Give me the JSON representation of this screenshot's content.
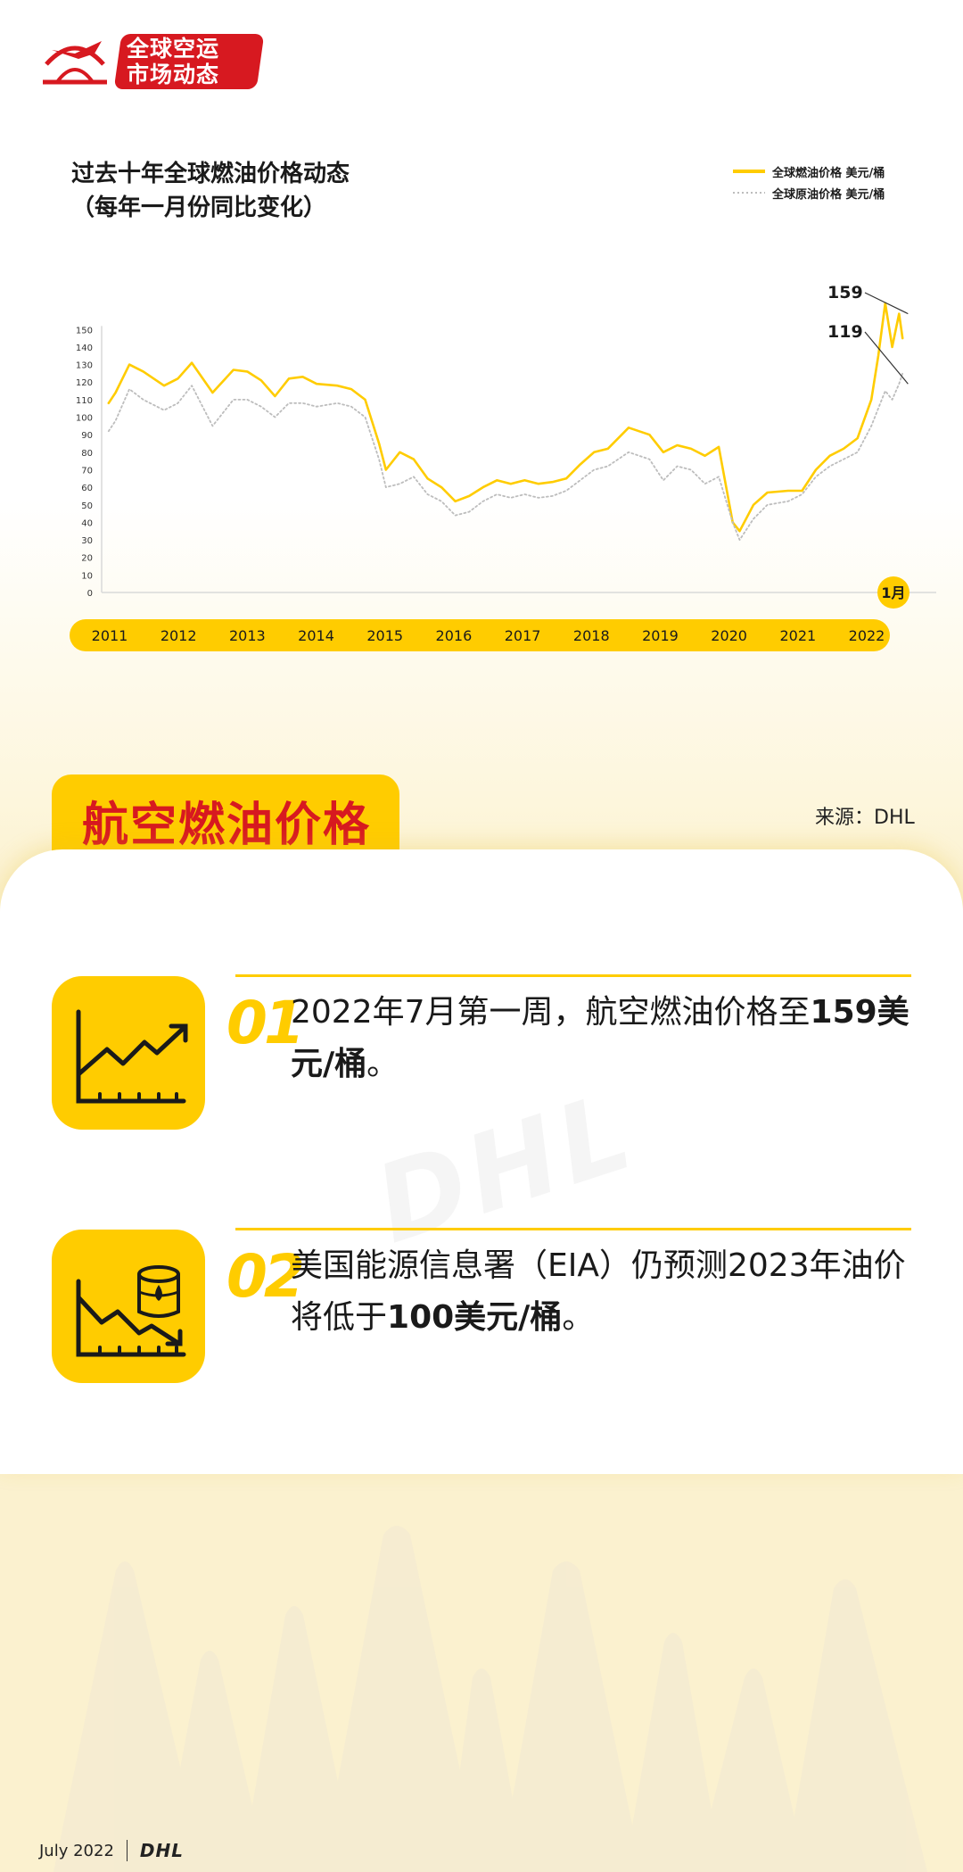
{
  "header": {
    "logo_line1": "全球空运",
    "logo_line2": "市场动态"
  },
  "chart_header": {
    "title": "过去十年全球燃油价格动态\n（每年一月份同比变化）"
  },
  "chart_data": {
    "type": "line",
    "title": "过去十年全球燃油价格动态（每年一月份同比变化）",
    "x_labels": [
      "2011",
      "2012",
      "2013",
      "2014",
      "2015",
      "2016",
      "2017",
      "2018",
      "2019",
      "2020",
      "2021",
      "2022"
    ],
    "y_ticks": [
      0,
      10,
      20,
      30,
      40,
      50,
      60,
      70,
      80,
      90,
      100,
      110,
      120,
      130,
      140,
      150
    ],
    "ylim": [
      0,
      150
    ],
    "grid": false,
    "legend": "top-right",
    "series": [
      {
        "name": "全球燃油价格 美元/桶",
        "color": "#ffcc00",
        "style": "solid",
        "points": [
          [
            2011.0,
            108
          ],
          [
            2011.1,
            114
          ],
          [
            2011.3,
            130
          ],
          [
            2011.5,
            126
          ],
          [
            2011.8,
            118
          ],
          [
            2012.0,
            122
          ],
          [
            2012.2,
            131
          ],
          [
            2012.5,
            114
          ],
          [
            2012.8,
            127
          ],
          [
            2013.0,
            126
          ],
          [
            2013.2,
            121
          ],
          [
            2013.4,
            112
          ],
          [
            2013.6,
            122
          ],
          [
            2013.8,
            123
          ],
          [
            2014.0,
            119
          ],
          [
            2014.3,
            118
          ],
          [
            2014.5,
            116
          ],
          [
            2014.7,
            110
          ],
          [
            2014.9,
            85
          ],
          [
            2015.0,
            70
          ],
          [
            2015.2,
            80
          ],
          [
            2015.4,
            76
          ],
          [
            2015.6,
            65
          ],
          [
            2015.8,
            60
          ],
          [
            2016.0,
            52
          ],
          [
            2016.2,
            55
          ],
          [
            2016.4,
            60
          ],
          [
            2016.6,
            64
          ],
          [
            2016.8,
            62
          ],
          [
            2017.0,
            64
          ],
          [
            2017.2,
            62
          ],
          [
            2017.4,
            63
          ],
          [
            2017.6,
            65
          ],
          [
            2017.8,
            73
          ],
          [
            2018.0,
            80
          ],
          [
            2018.2,
            82
          ],
          [
            2018.5,
            94
          ],
          [
            2018.8,
            90
          ],
          [
            2019.0,
            80
          ],
          [
            2019.2,
            84
          ],
          [
            2019.4,
            82
          ],
          [
            2019.6,
            78
          ],
          [
            2019.8,
            83
          ],
          [
            2020.0,
            40
          ],
          [
            2020.1,
            35
          ],
          [
            2020.3,
            50
          ],
          [
            2020.5,
            57
          ],
          [
            2020.8,
            58
          ],
          [
            2021.0,
            58
          ],
          [
            2021.2,
            70
          ],
          [
            2021.4,
            78
          ],
          [
            2021.6,
            82
          ],
          [
            2021.8,
            88
          ],
          [
            2022.0,
            110
          ],
          [
            2022.1,
            135
          ],
          [
            2022.2,
            165
          ],
          [
            2022.3,
            140
          ],
          [
            2022.4,
            159
          ],
          [
            2022.45,
            145
          ]
        ]
      },
      {
        "name": "全球原油价格 美元/桶",
        "color": "#bdbdbd",
        "style": "dotted",
        "points": [
          [
            2011.0,
            92
          ],
          [
            2011.1,
            98
          ],
          [
            2011.3,
            116
          ],
          [
            2011.5,
            110
          ],
          [
            2011.8,
            104
          ],
          [
            2012.0,
            108
          ],
          [
            2012.2,
            118
          ],
          [
            2012.5,
            95
          ],
          [
            2012.8,
            110
          ],
          [
            2013.0,
            110
          ],
          [
            2013.2,
            106
          ],
          [
            2013.4,
            100
          ],
          [
            2013.6,
            108
          ],
          [
            2013.8,
            108
          ],
          [
            2014.0,
            106
          ],
          [
            2014.3,
            108
          ],
          [
            2014.5,
            106
          ],
          [
            2014.7,
            100
          ],
          [
            2014.9,
            76
          ],
          [
            2015.0,
            60
          ],
          [
            2015.2,
            62
          ],
          [
            2015.4,
            66
          ],
          [
            2015.6,
            56
          ],
          [
            2015.8,
            52
          ],
          [
            2016.0,
            44
          ],
          [
            2016.2,
            46
          ],
          [
            2016.4,
            52
          ],
          [
            2016.6,
            56
          ],
          [
            2016.8,
            54
          ],
          [
            2017.0,
            56
          ],
          [
            2017.2,
            54
          ],
          [
            2017.4,
            55
          ],
          [
            2017.6,
            58
          ],
          [
            2017.8,
            64
          ],
          [
            2018.0,
            70
          ],
          [
            2018.2,
            72
          ],
          [
            2018.5,
            80
          ],
          [
            2018.8,
            76
          ],
          [
            2019.0,
            64
          ],
          [
            2019.2,
            72
          ],
          [
            2019.4,
            70
          ],
          [
            2019.6,
            62
          ],
          [
            2019.8,
            66
          ],
          [
            2020.0,
            40
          ],
          [
            2020.1,
            30
          ],
          [
            2020.3,
            42
          ],
          [
            2020.5,
            50
          ],
          [
            2020.8,
            52
          ],
          [
            2021.0,
            56
          ],
          [
            2021.2,
            66
          ],
          [
            2021.4,
            72
          ],
          [
            2021.6,
            76
          ],
          [
            2021.8,
            80
          ],
          [
            2022.0,
            95
          ],
          [
            2022.1,
            105
          ],
          [
            2022.2,
            115
          ],
          [
            2022.3,
            110
          ],
          [
            2022.4,
            119
          ],
          [
            2022.45,
            125
          ]
        ]
      }
    ],
    "annotations": [
      {
        "label": "159",
        "value": 159
      },
      {
        "label": "119",
        "value": 119
      }
    ],
    "end_marker": "1月"
  },
  "section": {
    "title": "航空燃油价格",
    "source": "来源：DHL"
  },
  "watermark": "DHL",
  "items": [
    {
      "number": "01",
      "text_plain": "2022年7月第一周，航空燃油价格至",
      "text_bold": "159美元/桶",
      "text_end": "。"
    },
    {
      "number": "02",
      "text_plain": "美国能源信息署（EIA）仍预测2023年油价将低于",
      "text_bold": "100美元/桶",
      "text_end": "。"
    }
  ],
  "footer": {
    "date": "July 2022",
    "brand": "DHL"
  }
}
